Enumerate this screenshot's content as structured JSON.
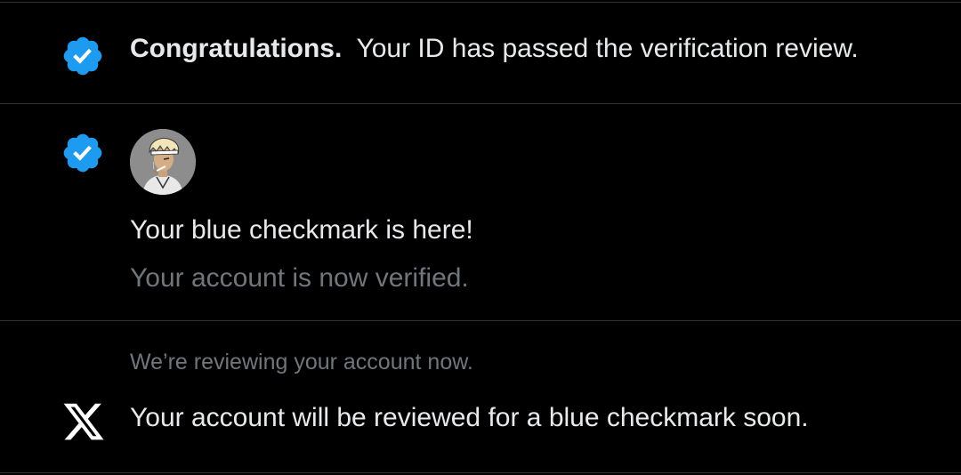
{
  "colors": {
    "background": "#000000",
    "divider": "#2f3336",
    "primary_text": "#e7e9ea",
    "secondary_text": "#71767b",
    "verified_blue": "#1d9bf0"
  },
  "notifications": [
    {
      "icon": "verified-badge-icon",
      "title": "Congratulations.",
      "message": "Your ID has passed the verification review."
    },
    {
      "icon": "verified-badge-icon",
      "avatar": "user-avatar",
      "title": "Your blue checkmark is here!",
      "subtitle": "Your account is now verified."
    },
    {
      "icon": "x-logo-icon",
      "header": "We’re reviewing your account now.",
      "message": "Your account will be reviewed for a blue checkmark soon."
    }
  ]
}
